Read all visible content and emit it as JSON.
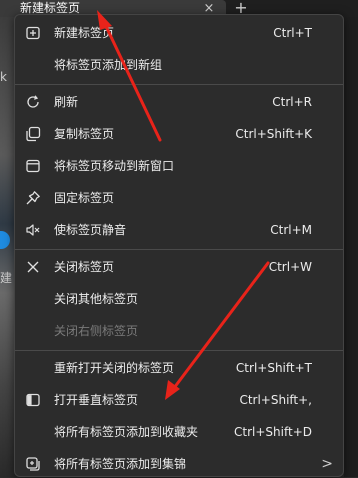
{
  "tab": {
    "title": "新建标签页",
    "close_glyph": "×",
    "new_tab_glyph": "+"
  },
  "background": {
    "glyph_1": "k",
    "glyph_2": "建"
  },
  "menu": {
    "items": [
      {
        "label": "新建标签页",
        "shortcut": "Ctrl+T",
        "icon": "new-tab-icon"
      },
      {
        "label": "将标签页添加到新组",
        "shortcut": "",
        "icon": ""
      },
      {
        "label": "刷新",
        "shortcut": "Ctrl+R",
        "icon": "refresh-icon"
      },
      {
        "label": "复制标签页",
        "shortcut": "Ctrl+Shift+K",
        "icon": "duplicate-icon"
      },
      {
        "label": "将标签页移动到新窗口",
        "shortcut": "",
        "icon": "window-icon"
      },
      {
        "label": "固定标签页",
        "shortcut": "",
        "icon": "pin-icon"
      },
      {
        "label": "使标签页静音",
        "shortcut": "Ctrl+M",
        "icon": "mute-icon"
      },
      {
        "label": "关闭标签页",
        "shortcut": "Ctrl+W",
        "icon": "close-icon"
      },
      {
        "label": "关闭其他标签页",
        "shortcut": "",
        "icon": ""
      },
      {
        "label": "关闭右侧标签页",
        "shortcut": "",
        "icon": "",
        "disabled": true
      },
      {
        "label": "重新打开关闭的标签页",
        "shortcut": "Ctrl+Shift+T",
        "icon": ""
      },
      {
        "label": "打开垂直标签页",
        "shortcut": "Ctrl+Shift+,",
        "icon": "vertical-tabs-icon"
      },
      {
        "label": "将所有标签页添加到收藏夹",
        "shortcut": "Ctrl+Shift+D",
        "icon": ""
      },
      {
        "label": "将所有标签页添加到集锦",
        "shortcut": "",
        "icon": "collections-icon",
        "submenu": ">"
      }
    ]
  },
  "colors": {
    "menu_bg": "#2c2c2c",
    "text": "#ececec",
    "disabled_text": "#7a7a7a",
    "arrow": "#e8231a"
  }
}
